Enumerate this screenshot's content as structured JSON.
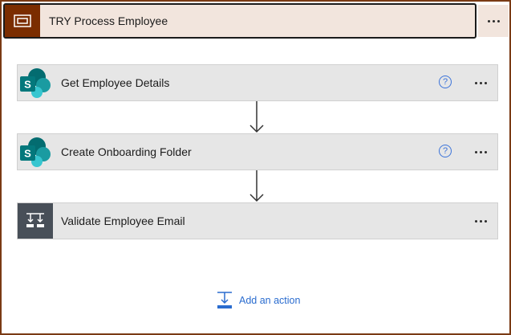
{
  "scope": {
    "title": "TRY Process Employee",
    "icon": "scope-icon",
    "accent_color": "#7b2d00",
    "header_bg": "#f2e5dd"
  },
  "actions": [
    {
      "label": "Get Employee Details",
      "icon": "sharepoint-icon",
      "help": "?"
    },
    {
      "label": "Create Onboarding Folder",
      "icon": "sharepoint-icon",
      "help": "?"
    },
    {
      "label": "Validate Employee Email",
      "icon": "condition-icon"
    }
  ],
  "add_action": {
    "label": "Add an action",
    "icon": "add-action-icon"
  }
}
